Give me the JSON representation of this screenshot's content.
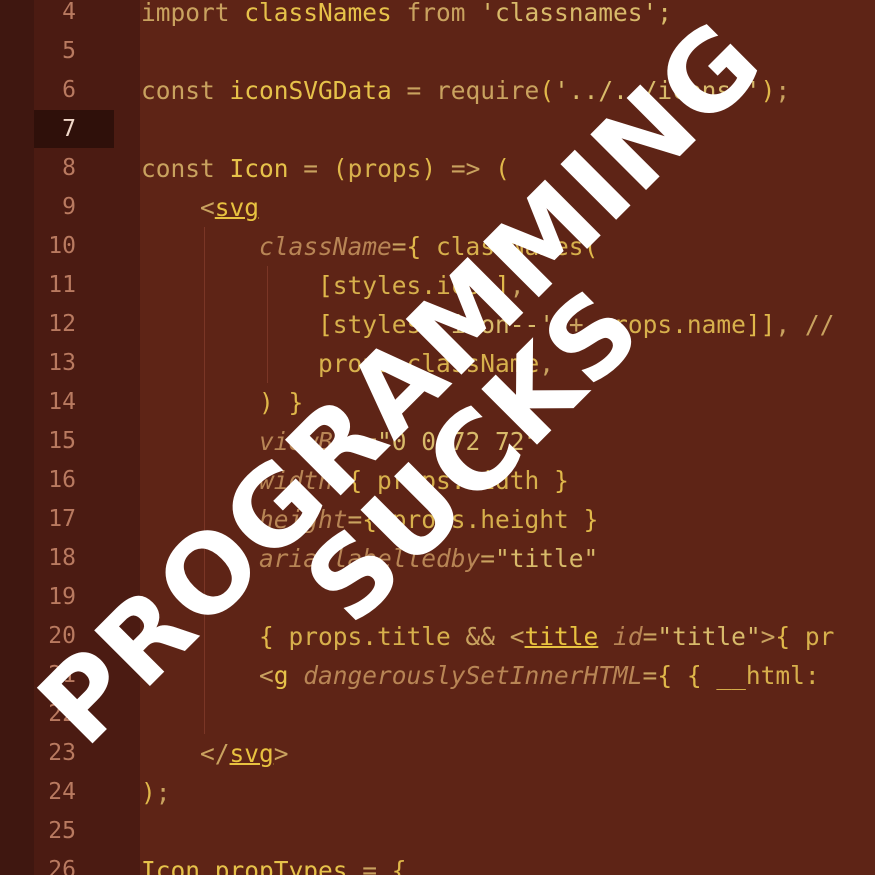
{
  "editor": {
    "active_line": "7",
    "lines": [
      {
        "no": "4",
        "tokens": [
          [
            "kw",
            "import "
          ],
          [
            "id",
            "classNames "
          ],
          [
            "kw",
            "from "
          ],
          [
            "str",
            "'classnames';"
          ]
        ]
      },
      {
        "no": "5",
        "tokens": []
      },
      {
        "no": "6",
        "tokens": [
          [
            "kw",
            "const "
          ],
          [
            "id",
            "iconSVGData "
          ],
          [
            "op",
            "= "
          ],
          [
            "kw",
            "require"
          ],
          [
            "br",
            "("
          ],
          [
            "str",
            "'../../icons/'"
          ],
          [
            "br",
            ")"
          ],
          [
            "op",
            ";"
          ]
        ]
      },
      {
        "no": "7",
        "tokens": []
      },
      {
        "no": "8",
        "tokens": [
          [
            "kw",
            "const "
          ],
          [
            "id",
            "Icon "
          ],
          [
            "op",
            "= "
          ],
          [
            "br",
            "("
          ],
          [
            "plain",
            "props"
          ],
          [
            "br",
            ")"
          ],
          [
            "op",
            " => "
          ],
          [
            "br",
            "("
          ]
        ]
      },
      {
        "no": "9",
        "tokens": [
          [
            "op",
            "    <"
          ],
          [
            "tag",
            "svg"
          ]
        ]
      },
      {
        "no": "10",
        "tokens": [
          [
            "attr",
            "        className"
          ],
          [
            "op",
            "="
          ],
          [
            "br",
            "{ "
          ],
          [
            "plain",
            "classNames"
          ],
          [
            "br",
            "("
          ]
        ]
      },
      {
        "no": "11",
        "tokens": [
          [
            "br",
            "            ["
          ],
          [
            "plain",
            "styles.icon"
          ],
          [
            "br",
            "]"
          ],
          [
            "op",
            ","
          ]
        ]
      },
      {
        "no": "12",
        "tokens": [
          [
            "br",
            "            ["
          ],
          [
            "plain",
            "styles"
          ],
          [
            "br",
            "["
          ],
          [
            "str",
            "'icon--'"
          ],
          [
            "op",
            " + "
          ],
          [
            "plain",
            "props.name"
          ],
          [
            "br",
            "]]"
          ],
          [
            "op",
            ", //"
          ]
        ]
      },
      {
        "no": "13",
        "tokens": [
          [
            "plain",
            "            props.className"
          ],
          [
            "op",
            ","
          ]
        ]
      },
      {
        "no": "14",
        "tokens": [
          [
            "br",
            "        ) }"
          ]
        ]
      },
      {
        "no": "15",
        "tokens": [
          [
            "attr",
            "        viewBox"
          ],
          [
            "op",
            "="
          ],
          [
            "str",
            "\"0 0 72 72\""
          ]
        ]
      },
      {
        "no": "16",
        "tokens": [
          [
            "attr",
            "        width"
          ],
          [
            "op",
            "="
          ],
          [
            "br",
            "{ "
          ],
          [
            "plain",
            "props.width"
          ],
          [
            "br",
            " }"
          ]
        ]
      },
      {
        "no": "17",
        "tokens": [
          [
            "attr",
            "        height"
          ],
          [
            "op",
            "="
          ],
          [
            "br",
            "{ "
          ],
          [
            "plain",
            "props.height"
          ],
          [
            "br",
            " }"
          ]
        ]
      },
      {
        "no": "18",
        "tokens": [
          [
            "attr",
            "        aria-labelledby"
          ],
          [
            "op",
            "="
          ],
          [
            "str",
            "\"title\""
          ]
        ]
      },
      {
        "no": "19",
        "tokens": []
      },
      {
        "no": "20",
        "tokens": [
          [
            "br",
            "        { "
          ],
          [
            "plain",
            "props.title "
          ],
          [
            "op",
            "&& <"
          ],
          [
            "tag",
            "title"
          ],
          [
            "attr",
            " id"
          ],
          [
            "op",
            "="
          ],
          [
            "str",
            "\"title\""
          ],
          [
            "op",
            ">"
          ],
          [
            "br",
            "{ "
          ],
          [
            "plain",
            "pr"
          ]
        ]
      },
      {
        "no": "21",
        "tokens": [
          [
            "op",
            "        <"
          ],
          [
            "id",
            "g"
          ],
          [
            "attr",
            " dangerouslySetInnerHTML"
          ],
          [
            "op",
            "="
          ],
          [
            "br",
            "{ { "
          ],
          [
            "plain",
            "__html:"
          ]
        ]
      },
      {
        "no": "22",
        "tokens": []
      },
      {
        "no": "23",
        "tokens": [
          [
            "op",
            "    </"
          ],
          [
            "tag",
            "svg"
          ],
          [
            "op",
            ">"
          ]
        ]
      },
      {
        "no": "24",
        "tokens": [
          [
            "br",
            ")"
          ],
          [
            "op",
            ";"
          ]
        ]
      },
      {
        "no": "25",
        "tokens": []
      },
      {
        "no": "26",
        "tokens": [
          [
            "id",
            "Icon.propTypes "
          ],
          [
            "op",
            "= "
          ],
          [
            "br",
            "{"
          ]
        ]
      }
    ]
  },
  "overlay": {
    "line1": "PROGRAMMING",
    "line2": "SUCKS"
  }
}
